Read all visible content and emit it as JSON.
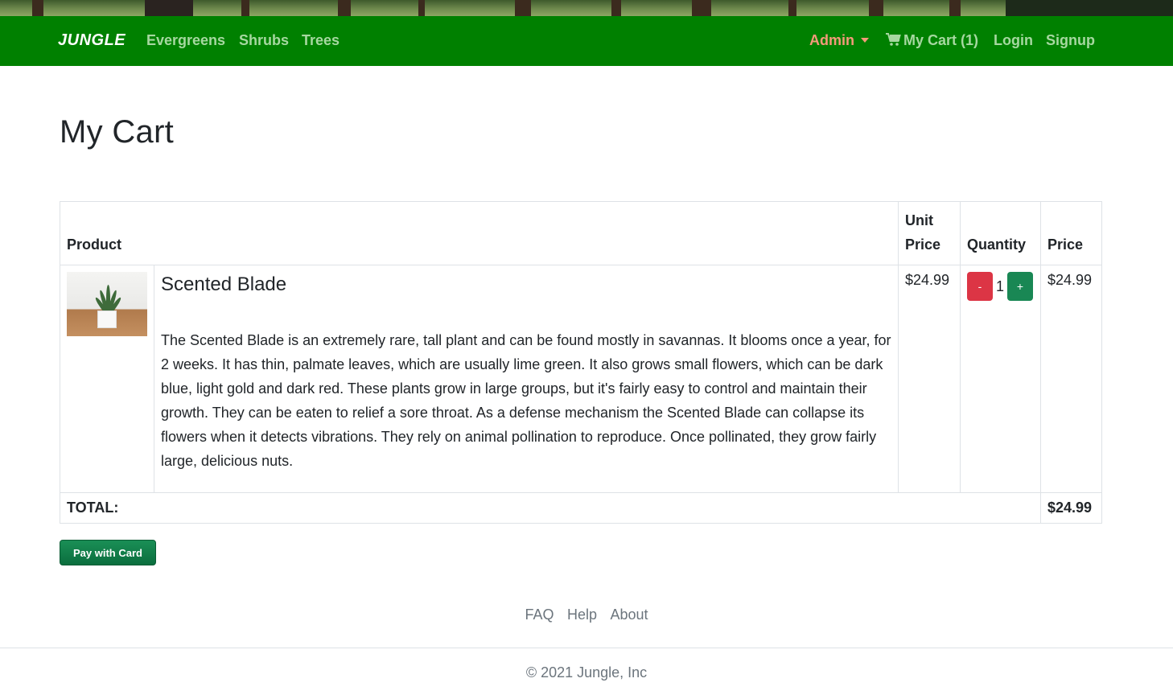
{
  "colors": {
    "navbar_bg": "#008000",
    "nav_link": "#a6d8a0",
    "admin_link": "#f59a7a",
    "minus_button": "#dc3545",
    "plus_button": "#198754",
    "pay_button": "#0b6e3e"
  },
  "navbar": {
    "brand": "JUNGLE",
    "links": [
      "Evergreens",
      "Shrubs",
      "Trees"
    ],
    "admin_label": "Admin",
    "cart_label": "My Cart (1)",
    "cart_icon": "shopping-cart-icon",
    "login_label": "Login",
    "signup_label": "Signup"
  },
  "page": {
    "title": "My Cart"
  },
  "table": {
    "headers": {
      "product": "Product",
      "unit_price_line1": "Unit",
      "unit_price_line2": "Price",
      "quantity": "Quantity",
      "price": "Price"
    },
    "items": [
      {
        "image": "snake-plant-thumbnail",
        "name": "Scented Blade",
        "description": "The Scented Blade is an extremely rare, tall plant and can be found mostly in savannas. It blooms once a year, for 2 weeks. It has thin, palmate leaves, which are usually lime green. It also grows small flowers, which can be dark blue, light gold and dark red. These plants grow in large groups, but it's fairly easy to control and maintain their growth. They can be eaten to relief a sore throat. As a defense mechanism the Scented Blade can collapse its flowers when it detects vibrations. They rely on animal pollination to reproduce. Once pollinated, they grow fairly large, delicious nuts.",
        "unit_price": "$24.99",
        "quantity": "1",
        "minus_label": "-",
        "plus_label": "+",
        "price": "$24.99"
      }
    ],
    "total_label": "TOTAL:",
    "total_value": "$24.99"
  },
  "checkout": {
    "pay_label": "Pay with Card"
  },
  "footer": {
    "links": [
      "FAQ",
      "Help",
      "About"
    ],
    "copyright": "© 2021 Jungle, Inc"
  }
}
